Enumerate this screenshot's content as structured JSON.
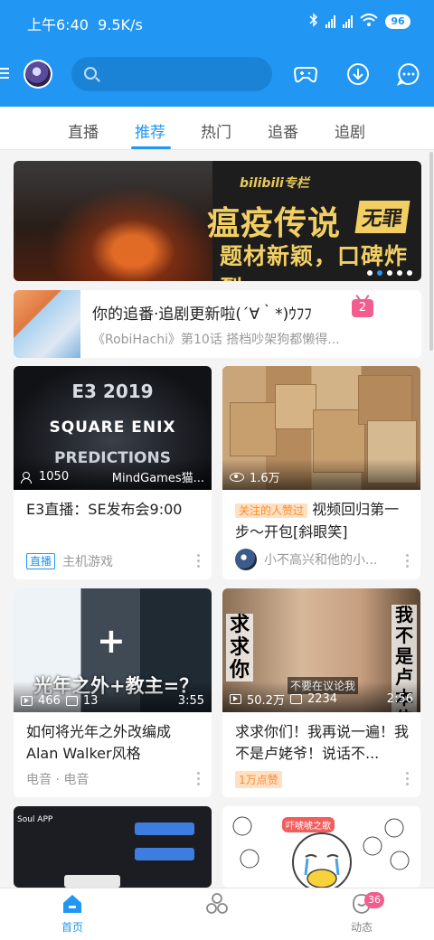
{
  "status_bar": {
    "time": "上午6:40",
    "net_speed": "9.5K/s",
    "battery": "96"
  },
  "search": {
    "placeholder": ""
  },
  "tabs": [
    {
      "label": "直播"
    },
    {
      "label": "推荐",
      "active": true
    },
    {
      "label": "热门"
    },
    {
      "label": "追番"
    },
    {
      "label": "追剧"
    }
  ],
  "banner": {
    "logo": "bilibili专栏",
    "title": "瘟疫传说",
    "badge": "无罪",
    "subtitle": "题材新颖，口碑炸裂",
    "dots": 5,
    "active_dot": 1
  },
  "follow_update": {
    "title": "你的追番·追剧更新啦(´∀｀*)ｳﾌﾌ",
    "badge": "2",
    "subtitle": "《RobiHachi》第10话 搭档吵架狗都懒得..."
  },
  "cards": [
    {
      "thumb_lines": [
        "E3 2019",
        "SQUARE ENIX",
        "PREDICTIONS"
      ],
      "stat1": "1050",
      "channel": "MindGames猫...",
      "title": "E3直播：SE发布会9:00",
      "tag": "直播",
      "meta": "主机游戏"
    },
    {
      "stat1": "1.6万",
      "title_tag": "关注的人赞过",
      "title": "视频回归第一步～开包[斜眼笑]",
      "meta": "小不高兴和他的小..."
    },
    {
      "thumb_text": "光年之外+教主=？",
      "stat1": "466",
      "stat2": "13",
      "duration": "3:55",
      "title": "如何将光年之外改编成Alan Walker风格",
      "meta": "电音 · 电音"
    },
    {
      "thumb_left": "求求你",
      "thumb_right": "我不是卢本伟",
      "thumb_caption": "不要在议论我",
      "stat1": "50.2万",
      "stat2": "2234",
      "duration": "2:56",
      "title": "求求你们！我再说一遍！我不是卢姥爷！说话不...",
      "tag": "1万点赞"
    },
    {
      "thumb_text": "Soul APP"
    },
    {
      "thumb_text": "吓唬唬之歌"
    }
  ],
  "bottom_nav": [
    {
      "label": "首页",
      "active": true
    },
    {
      "label": ""
    },
    {
      "label": "动态",
      "badge": "36"
    }
  ],
  "colors": {
    "brand": "#2196f3",
    "pink": "#f25d8e",
    "orange": "#ff8a2c"
  }
}
